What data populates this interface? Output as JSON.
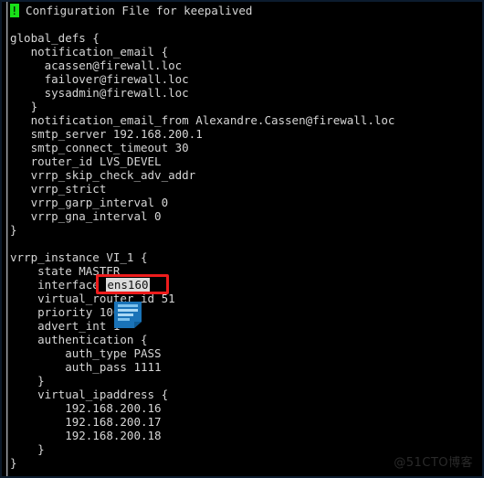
{
  "window": {
    "type": "terminal",
    "background_color": "#000000",
    "foreground_color": "#d6d6d6"
  },
  "cursor": {
    "char": "!",
    "color": "#18e018",
    "text_color": "#000000"
  },
  "editor": {
    "header_rest": " Configuration File for keepalived",
    "lines": [
      "",
      "global_defs {",
      "   notification_email {",
      "     acassen@firewall.loc",
      "     failover@firewall.loc",
      "     sysadmin@firewall.loc",
      "   }",
      "   notification_email_from Alexandre.Cassen@firewall.loc",
      "   smtp_server 192.168.200.1",
      "   smtp_connect_timeout 30",
      "   router_id LVS_DEVEL",
      "   vrrp_skip_check_adv_addr",
      "   vrrp_strict",
      "   vrrp_garp_interval 0",
      "   vrrp_gna_interval 0",
      "}",
      "",
      "vrrp_instance VI_1 {",
      "    state MASTER",
      "    virtual_router_id 51",
      "    priority 100",
      "    advert_int 1",
      "    authentication {",
      "        auth_type PASS",
      "        auth_pass 1111",
      "    }",
      "    virtual_ipaddress {",
      "        192.168.200.16",
      "        192.168.200.17",
      "        192.168.200.18",
      "    }",
      "}"
    ],
    "interface_line": {
      "prefix": "    interface ",
      "selected_value": "ens160",
      "selection_bg": "#dcdcdc",
      "selection_fg": "#101010"
    }
  },
  "annotation": {
    "shape": "rectangle",
    "color": "#ee1c1c",
    "targets": "ens160"
  },
  "drag_icon": {
    "name": "document-drag-cursor",
    "color": "#1a73b8",
    "accent_color": "#63b3ee"
  },
  "watermark": {
    "text": "@51CTO博客",
    "color": "#2a2a2a"
  }
}
